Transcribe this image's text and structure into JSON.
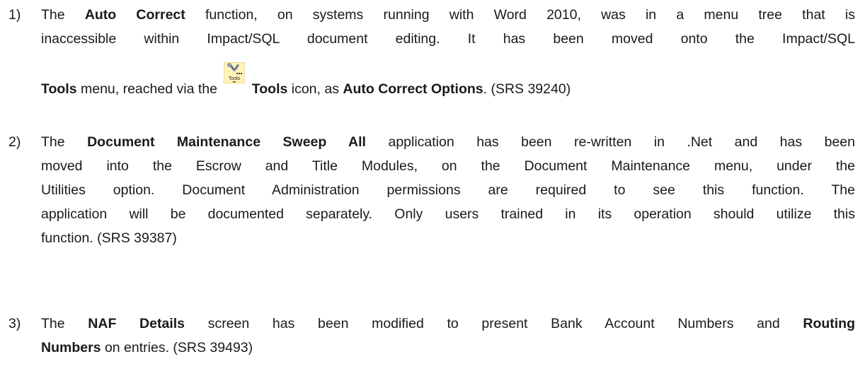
{
  "items": [
    {
      "number": "1)",
      "lines": {
        "l1": {
          "a": "The ",
          "b1": "Auto Correct",
          "c": " function, on systems running with Word 2010, was in a menu tree that is"
        },
        "l2": {
          "a": "inaccessible within Impact/SQL document editing.  It has been moved onto the Impact/SQL"
        },
        "l3": {
          "b1": "Tools",
          "a": " menu, reached via the ",
          "icon_label": "Tools",
          "b2": " Tools",
          "c": " icon, as ",
          "b3": "Auto Correct Options",
          "d": ".  (SRS 39240)"
        }
      }
    },
    {
      "number": "2)",
      "lines": {
        "l1": {
          "a": "The ",
          "b1": "Document Maintenance Sweep All",
          "c": " application has been re-written in .Net and has been"
        },
        "l2": {
          "a": "moved into the Escrow and Title Modules, on the Document Maintenance menu, under the"
        },
        "l3": {
          "a": "Utilities option.  Document Administration permissions are required to see this function.  The"
        },
        "l4": {
          "a": "application will be documented separately.  Only users trained in its operation should utilize this"
        },
        "l5": {
          "a": "function.  (SRS 39387)"
        }
      }
    },
    {
      "number": "3)",
      "lines": {
        "l1": {
          "a": "The ",
          "b1": "NAF Details",
          "c": " screen has been modified to present Bank Account Numbers and ",
          "b2": "Routing"
        },
        "l2": {
          "b1": "Numbers",
          "a": " on entries.  (SRS 39493)"
        }
      }
    }
  ]
}
